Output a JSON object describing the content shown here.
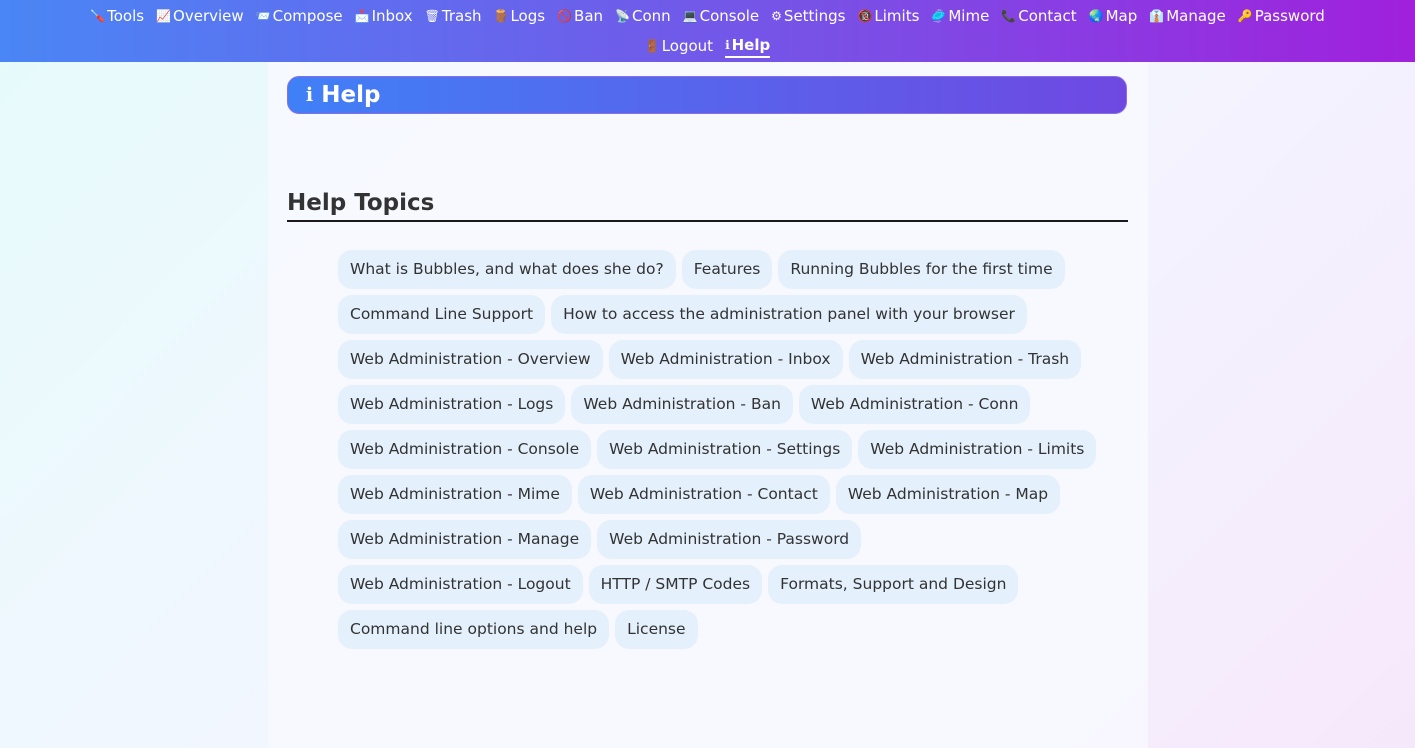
{
  "nav": {
    "items": [
      {
        "icon": "🪛",
        "icon_name": "screwdriver-icon",
        "label": "Tools"
      },
      {
        "icon": "📈",
        "icon_name": "chart-icon",
        "label": "Overview"
      },
      {
        "icon": "📨",
        "icon_name": "envelope-send-icon",
        "label": "Compose"
      },
      {
        "icon": "📩",
        "icon_name": "inbox-icon",
        "label": "Inbox"
      },
      {
        "icon": "🗑",
        "icon_name": "trash-icon",
        "label": "Trash"
      },
      {
        "icon": "🪵",
        "icon_name": "log-icon",
        "label": "Logs"
      },
      {
        "icon": "🚫",
        "icon_name": "ban-icon",
        "label": "Ban"
      },
      {
        "icon": "📡",
        "icon_name": "satellite-icon",
        "label": "Conn"
      },
      {
        "icon": "💻",
        "icon_name": "laptop-icon",
        "label": "Console"
      },
      {
        "icon": "⚙",
        "icon_name": "gear-icon",
        "label": "Settings"
      },
      {
        "icon": "🔞",
        "icon_name": "limit-icon",
        "label": "Limits"
      },
      {
        "icon": "🥏",
        "icon_name": "disc-icon",
        "label": "Mime"
      },
      {
        "icon": "📞",
        "icon_name": "phone-icon",
        "label": "Contact"
      },
      {
        "icon": "🌏",
        "icon_name": "globe-icon",
        "label": "Map"
      },
      {
        "icon": "👔",
        "icon_name": "manager-icon",
        "label": "Manage"
      },
      {
        "icon": "🔑",
        "icon_name": "key-icon",
        "label": "Password"
      },
      {
        "icon": "🚪",
        "icon_name": "door-icon",
        "label": "Logout"
      },
      {
        "icon": "ℹ",
        "icon_name": "info-icon",
        "label": "Help"
      }
    ]
  },
  "page": {
    "title_icon": "ℹ",
    "title": "Help",
    "section_heading": "Help Topics"
  },
  "topics": [
    "What is Bubbles, and what does she do?",
    "Features",
    "Running Bubbles for the first time",
    "Command Line Support",
    "How to access the administration panel with your browser",
    "Web Administration - Overview",
    "Web Administration - Inbox",
    "Web Administration - Trash",
    "Web Administration - Logs",
    "Web Administration - Ban",
    "Web Administration - Conn",
    "Web Administration - Console",
    "Web Administration - Settings",
    "Web Administration - Limits",
    "Web Administration - Mime",
    "Web Administration - Contact",
    "Web Administration - Map",
    "Web Administration - Manage",
    "Web Administration - Password",
    "Web Administration - Logout",
    "HTTP / SMTP Codes",
    "Formats, Support and Design",
    "Command line options and help",
    "License"
  ]
}
